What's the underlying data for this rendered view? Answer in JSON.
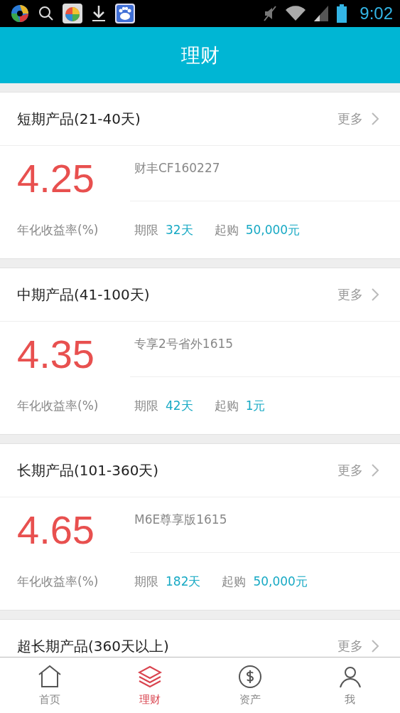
{
  "status_bar": {
    "time": "9:02"
  },
  "header": {
    "title": "理财"
  },
  "sections": [
    {
      "title": "短期产品(21-40天)",
      "more": "更多",
      "rate": "4.25",
      "rate_label": "年化收益率(%)",
      "product": "财丰CF160227",
      "term_label": "期限",
      "term": "32天",
      "min_label": "起购",
      "min": "50,000元"
    },
    {
      "title": "中期产品(41-100天)",
      "more": "更多",
      "rate": "4.35",
      "rate_label": "年化收益率(%)",
      "product": "专享2号省外1615",
      "term_label": "期限",
      "term": "42天",
      "min_label": "起购",
      "min": "1元"
    },
    {
      "title": "长期产品(101-360天)",
      "more": "更多",
      "rate": "4.65",
      "rate_label": "年化收益率(%)",
      "product": "M6E尊享版1615",
      "term_label": "期限",
      "term": "182天",
      "min_label": "起购",
      "min": "50,000元"
    },
    {
      "title": "超长期产品(360天以上)",
      "more": "更多"
    }
  ],
  "tab_bar": [
    {
      "kind": "home",
      "label": "首页",
      "selected": false
    },
    {
      "kind": "finance",
      "label": "理财",
      "selected": true
    },
    {
      "kind": "assets",
      "label": "资产",
      "selected": false
    },
    {
      "kind": "me",
      "label": "我",
      "selected": false
    }
  ]
}
